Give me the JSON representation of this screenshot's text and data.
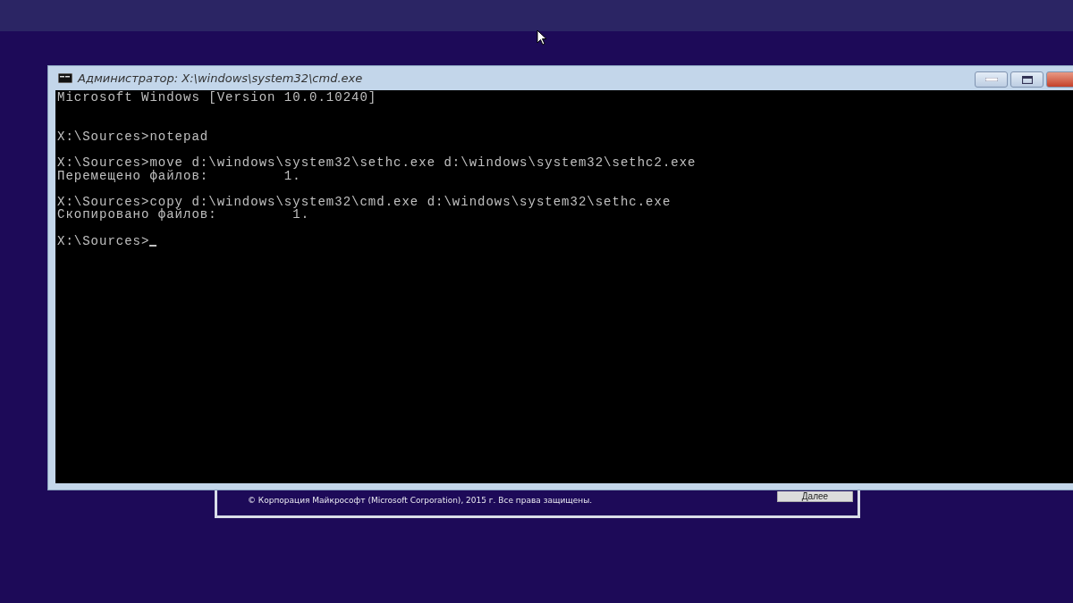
{
  "setup_dialog": {
    "copyright": "© Корпорация Майкрософт (Microsoft Corporation), 2015 г. Все права защищены.",
    "next_button": "Далее"
  },
  "console_window": {
    "title": "Администратор: X:\\windows\\system32\\cmd.exe",
    "lines": [
      {
        "kind": "text",
        "text": "Microsoft Windows [Version 10.0.10240]"
      },
      {
        "kind": "blank"
      },
      {
        "kind": "blank"
      },
      {
        "kind": "text",
        "text": "X:\\Sources>notepad"
      },
      {
        "kind": "blank"
      },
      {
        "kind": "text",
        "text": "X:\\Sources>move d:\\windows\\system32\\sethc.exe d:\\windows\\system32\\sethc2.exe"
      },
      {
        "kind": "text",
        "text": "Перемещено файлов:         1."
      },
      {
        "kind": "blank"
      },
      {
        "kind": "text",
        "text": "X:\\Sources>copy d:\\windows\\system32\\cmd.exe d:\\windows\\system32\\sethc.exe"
      },
      {
        "kind": "text",
        "text": "Скопировано файлов:         1."
      },
      {
        "kind": "blank"
      },
      {
        "kind": "text",
        "text": "X:\\Sources>",
        "cursor": true
      }
    ]
  }
}
